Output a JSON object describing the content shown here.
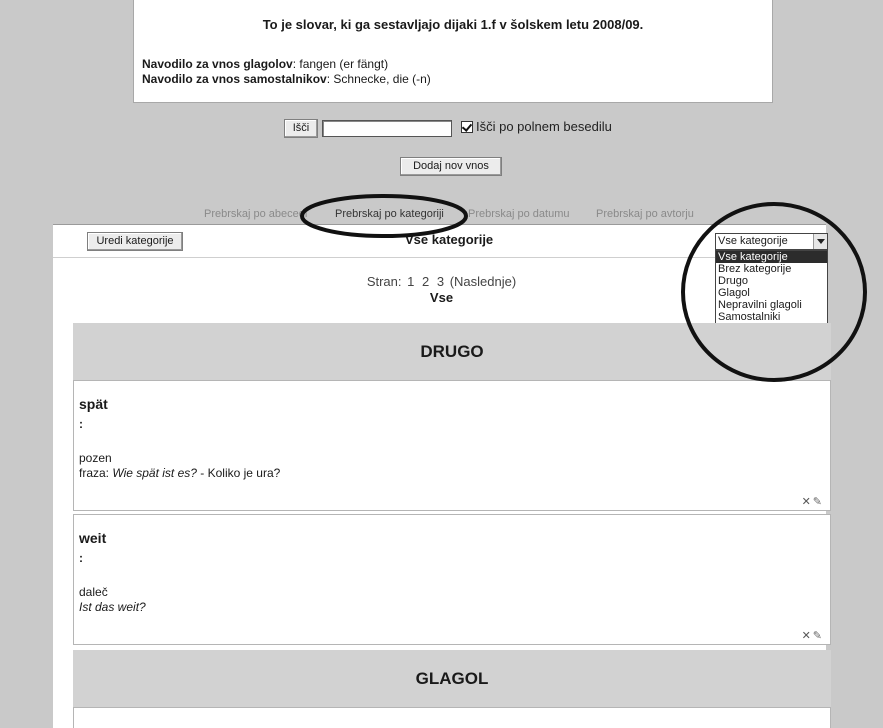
{
  "intro": {
    "title": "To je slovar, ki ga sestavljajo dijaki 1.f v šolskem letu 2008/09.",
    "verbs_label": "Navodilo za vnos glagolov",
    "verbs_value": ": fangen (er fängt)",
    "nouns_label": "Navodilo za vnos samostalnikov",
    "nouns_value": ": Schnecke, die (-n)"
  },
  "search": {
    "button": "Išči",
    "value": "",
    "fulltext_checked": true,
    "fulltext_label": "Išči po polnem besedilu",
    "add_entry": "Dodaj nov vnos"
  },
  "tabs": [
    "Prebrskaj po abecedi",
    "Prebrskaj po kategoriji",
    "Prebrskaj po datumu",
    "Prebrskaj po avtorju"
  ],
  "toolbar": {
    "edit_categories": "Uredi kategorije",
    "heading": "Vse kategorije",
    "select_value": "Vse kategorije",
    "options": [
      "Vse kategorije",
      "Brez kategorije",
      "Drugo",
      "Glagol",
      "Nepravilni glagoli",
      "Samostalniki"
    ]
  },
  "pager": {
    "label": "Stran:",
    "pages": [
      "1",
      "2",
      "3"
    ],
    "next": "(Naslednje)",
    "current": "Vse"
  },
  "sections": [
    {
      "title": "DRUGO",
      "entries": [
        {
          "word": "spät",
          "colon": ":",
          "line1": "pozen",
          "line2_prefix": "fraza: ",
          "line2_italic": "Wie spät ist es?",
          "line2_suffix": " - Koliko je ura?"
        },
        {
          "word": "weit",
          "colon": ":",
          "line1": "daleč",
          "line2_italic": "Ist das weit?"
        }
      ]
    },
    {
      "title": "GLAGOL"
    }
  ],
  "icons": {
    "delete": "x-icon",
    "edit": "edit-icon"
  }
}
